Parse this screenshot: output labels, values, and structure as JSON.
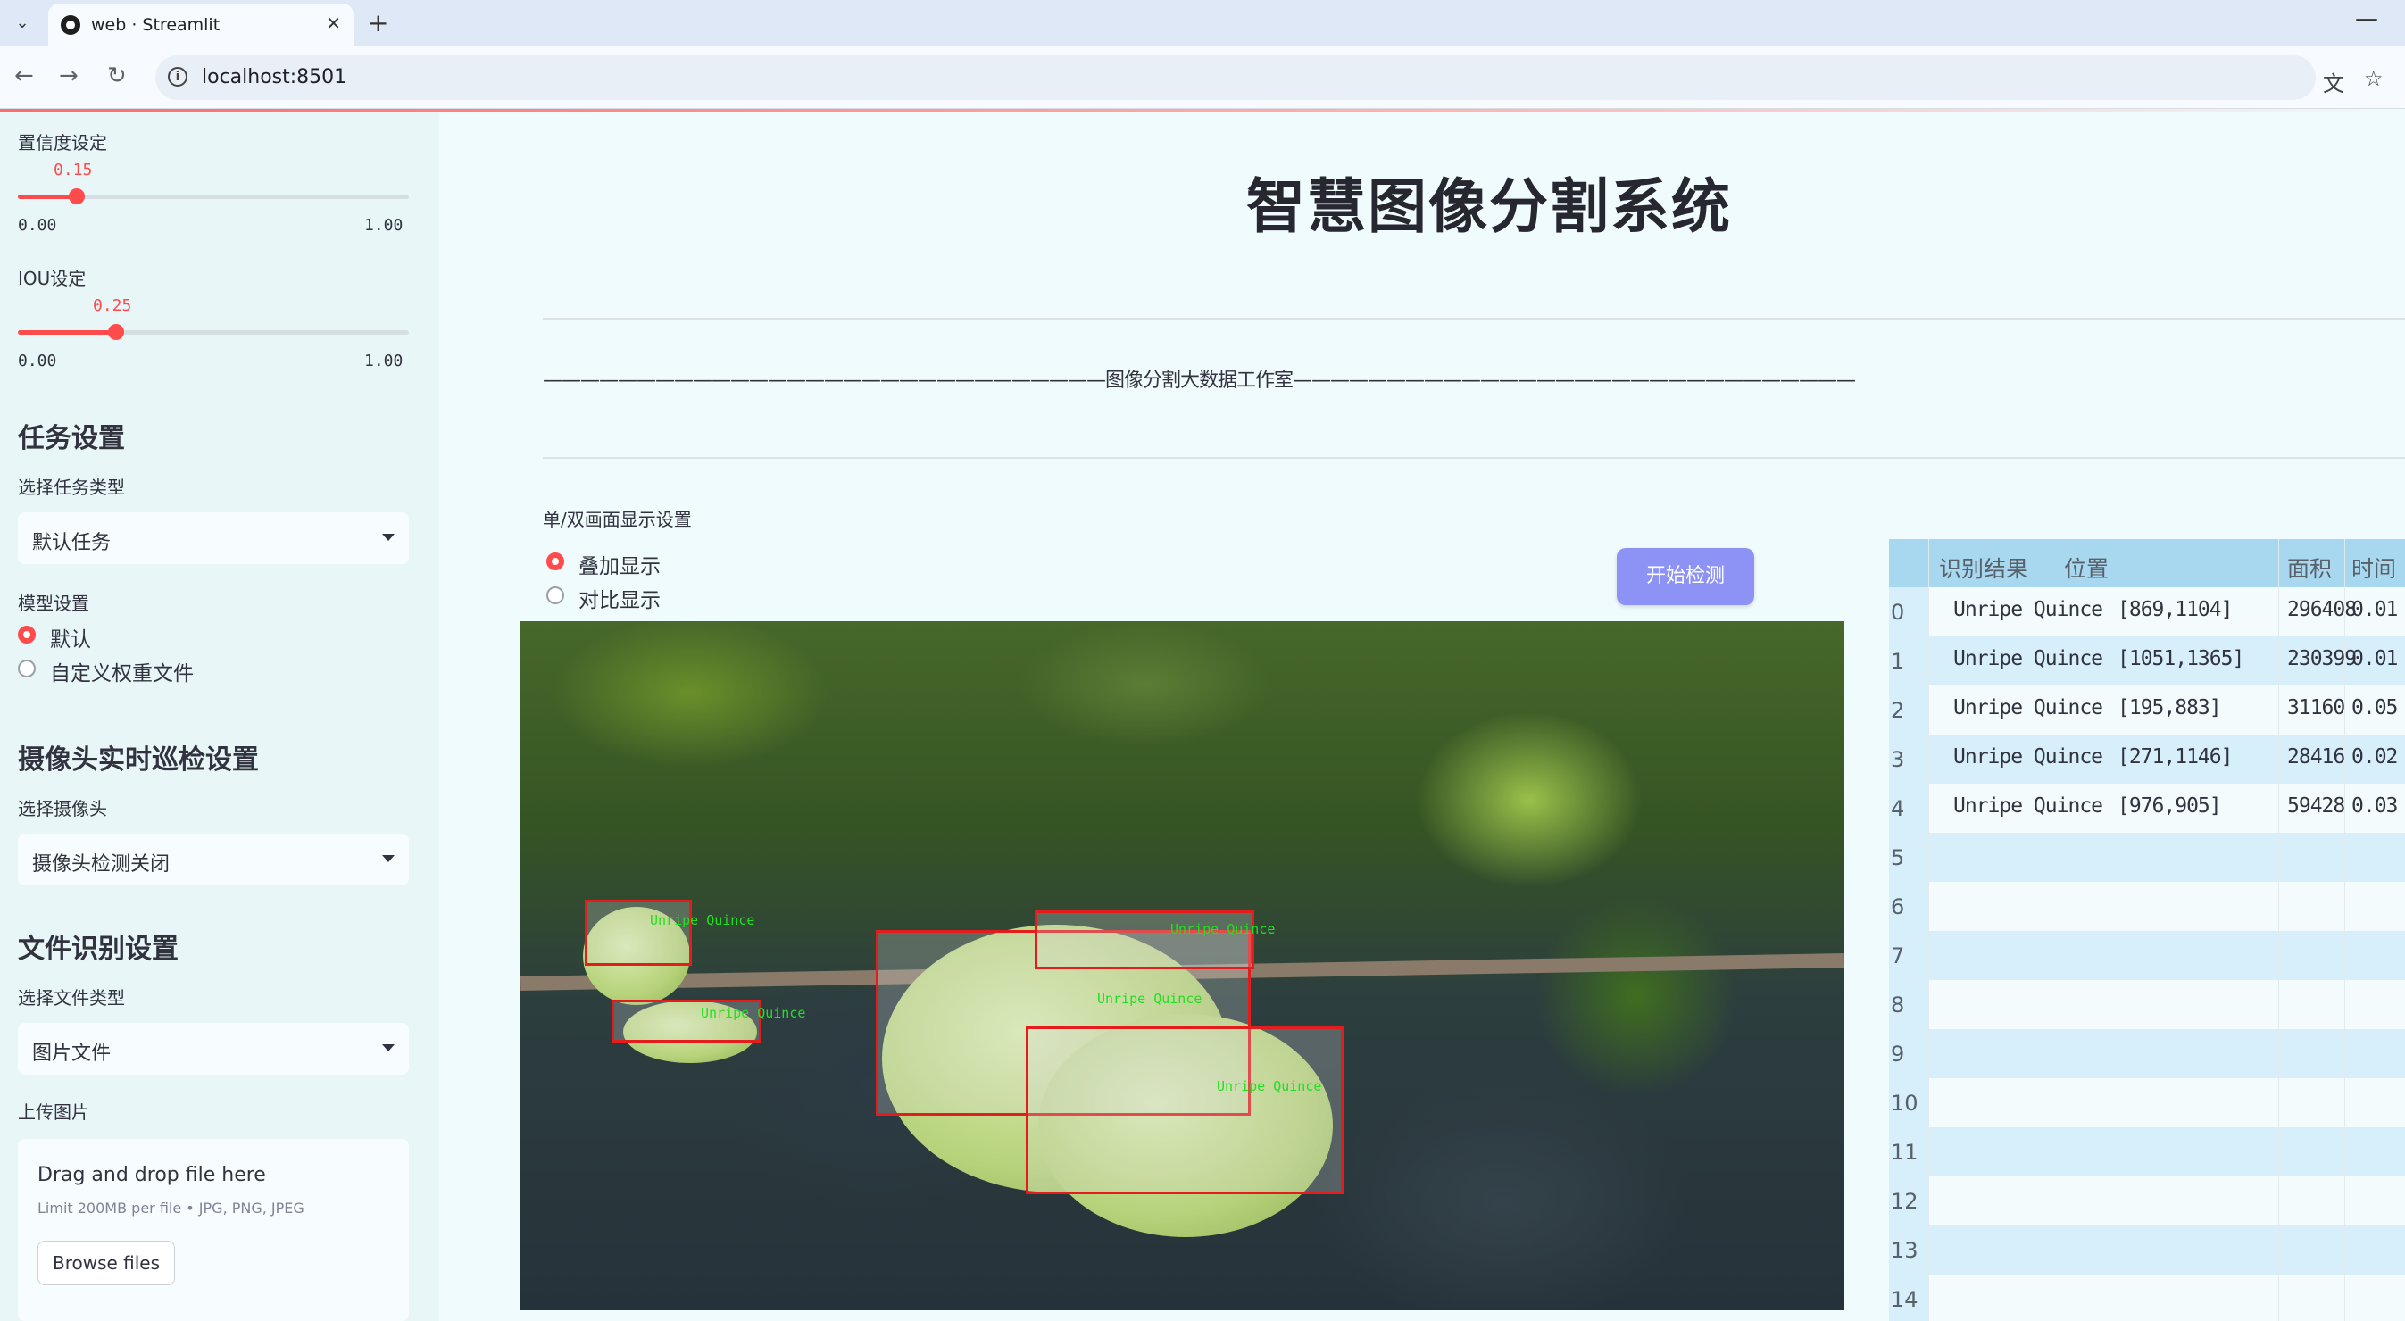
{
  "browser": {
    "tab_title": "web · Streamlit",
    "url": "localhost:8501"
  },
  "sidebar": {
    "confidence": {
      "label": "置信度设定",
      "value": "0.15",
      "fraction": 0.15,
      "min": "0.00",
      "max": "1.00"
    },
    "iou": {
      "label": "IOU设定",
      "value": "0.25",
      "fraction": 0.25,
      "min": "0.00",
      "max": "1.00"
    },
    "task_heading": "任务设置",
    "task_type_label": "选择任务类型",
    "task_type_value": "默认任务",
    "model_label": "模型设置",
    "model_options": [
      {
        "label": "默认",
        "selected": true
      },
      {
        "label": "自定义权重文件",
        "selected": false
      }
    ],
    "camera_heading": "摄像头实时巡检设置",
    "camera_label": "选择摄像头",
    "camera_value": "摄像头检测关闭",
    "file_heading": "文件识别设置",
    "file_type_label": "选择文件类型",
    "file_type_value": "图片文件",
    "upload_label": "上传图片",
    "uploader": {
      "title": "Drag and drop file here",
      "limit": "Limit 200MB per file • JPG, PNG, JPEG",
      "button": "Browse files"
    }
  },
  "main": {
    "title": "智慧图像分割系统",
    "divider_text": "——————————————————————————————图像分割大数据工作室——————————————————————————————",
    "display_label": "单/双画面显示设置",
    "display_options": [
      {
        "label": "叠加显示",
        "selected": true
      },
      {
        "label": "对比显示",
        "selected": false
      }
    ],
    "start_button": "开始检测",
    "detections": [
      {
        "label": "Unripe Quince"
      },
      {
        "label": "Unripe Quince"
      },
      {
        "label": "Unripe Quince"
      },
      {
        "label": "Unripe Quince"
      },
      {
        "label": "Unripe Quince"
      }
    ]
  },
  "results_table": {
    "columns": [
      "识别结果",
      "位置",
      "面积",
      "时间"
    ],
    "rows": [
      {
        "index": "0",
        "result": "Unripe Quince",
        "position": "[869,1104]",
        "area": "296408",
        "time": "0.01"
      },
      {
        "index": "1",
        "result": "Unripe Quince",
        "position": "[1051,1365]",
        "area": "230399",
        "time": "0.01"
      },
      {
        "index": "2",
        "result": "Unripe Quince",
        "position": "[195,883]",
        "area": "31160",
        "time": "0.05"
      },
      {
        "index": "3",
        "result": "Unripe Quince",
        "position": "[271,1146]",
        "area": "28416",
        "time": "0.02"
      },
      {
        "index": "4",
        "result": "Unripe Quince",
        "position": "[976,905]",
        "area": "59428",
        "time": "0.03"
      },
      {
        "index": "5"
      },
      {
        "index": "6"
      },
      {
        "index": "7"
      },
      {
        "index": "8"
      },
      {
        "index": "9"
      },
      {
        "index": "10"
      },
      {
        "index": "11"
      },
      {
        "index": "12"
      },
      {
        "index": "13"
      },
      {
        "index": "14"
      }
    ]
  }
}
